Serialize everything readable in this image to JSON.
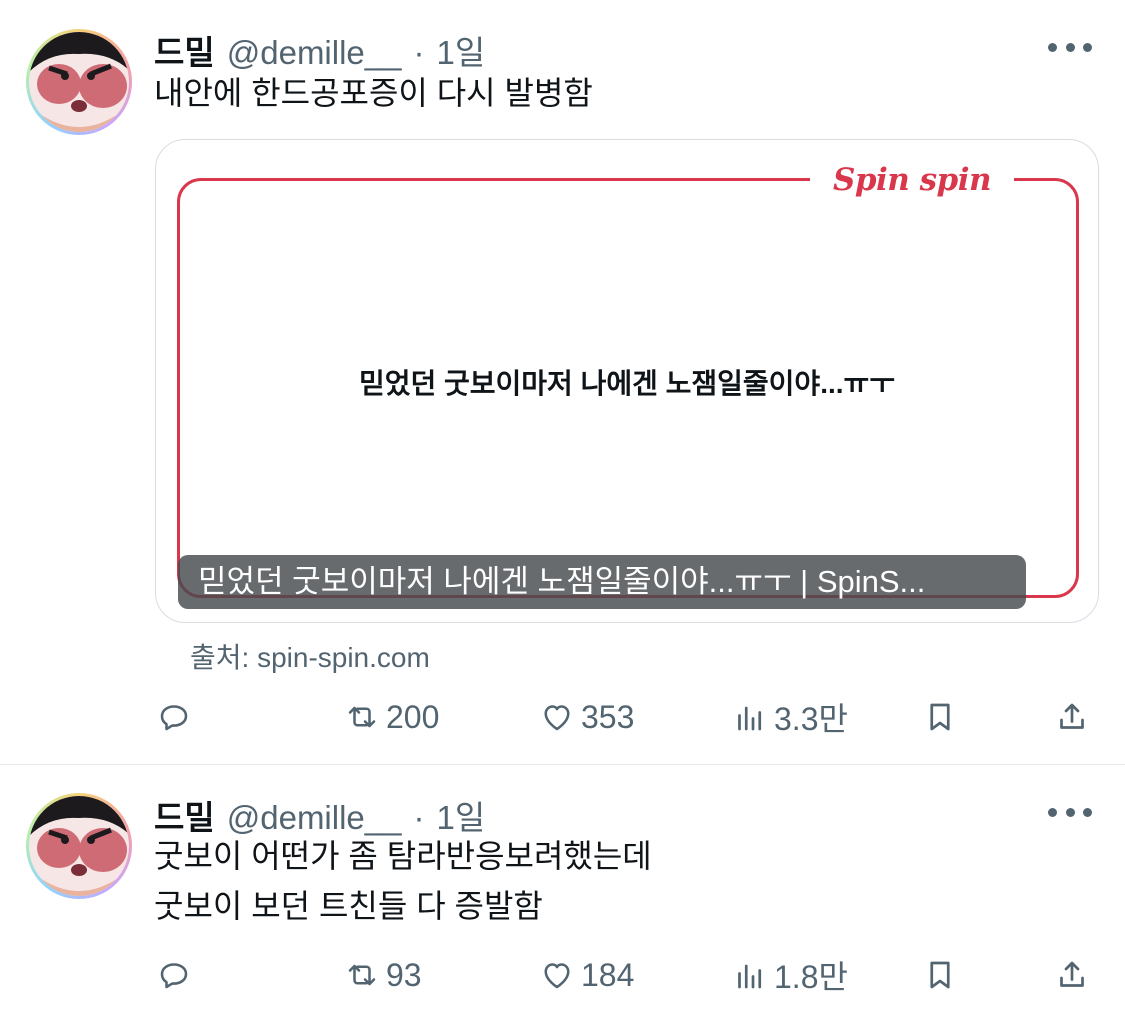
{
  "tweets": [
    {
      "name": "드밀",
      "handle": "@demille__",
      "dot": "·",
      "time": "1일",
      "lines": [
        "내안에 한드공포증이 다시 발병함"
      ],
      "card": {
        "brand": "Spin spin",
        "headline": "믿었던 굿보이마저 나에겐 노잼일줄이야...ㅠㅜ",
        "caption": "믿었던 굿보이마저 나에겐 노잼일줄이야...ㅠㅜ | SpinS...",
        "source": "출처: spin-spin.com"
      },
      "stats": {
        "retweets": "200",
        "likes": "353",
        "views": "3.3만"
      }
    },
    {
      "name": "드밀",
      "handle": "@demille__",
      "dot": "·",
      "time": "1일",
      "lines": [
        "굿보이 어떤가 좀 탐라반응보려했는데",
        "굿보이 보던 트친들 다 증발함"
      ],
      "stats": {
        "retweets": "93",
        "likes": "184",
        "views": "1.8만"
      }
    }
  ],
  "icons": [
    "reply-icon",
    "retweet-icon",
    "like-icon",
    "views-icon",
    "bookmark-icon",
    "share-icon",
    "more-icon"
  ],
  "colors": {
    "text": "#0f1419",
    "secondary": "#536471",
    "brand_red": "#d9374b",
    "divider": "#e6e9ec"
  }
}
